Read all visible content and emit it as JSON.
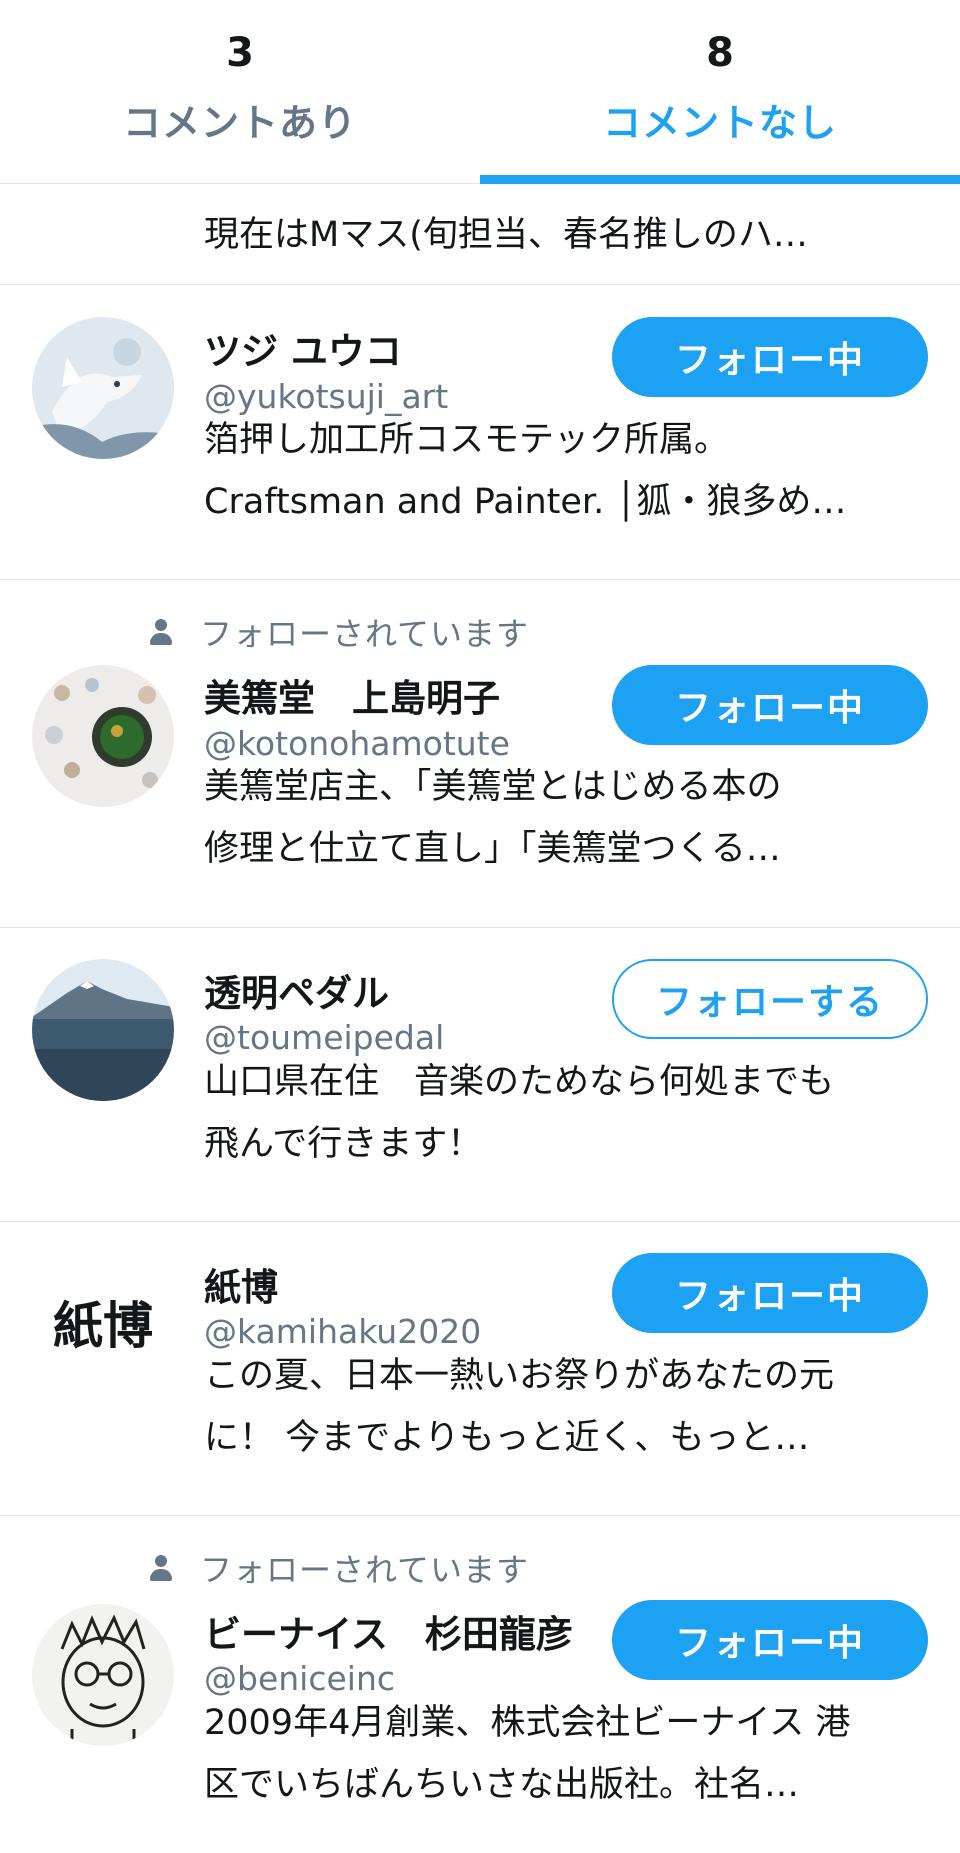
{
  "tabs": [
    {
      "count": "3",
      "label": "コメントあり",
      "active": false
    },
    {
      "count": "8",
      "label": "コメントなし",
      "active": true
    }
  ],
  "first_row": {
    "bio_line": "現在はMマス(旬担当、春名推しのハ…"
  },
  "users": [
    {
      "name": "ツジ ユウコ",
      "handle": "@yukotsuji_art",
      "followed_by": "",
      "button": "フォロー中",
      "bio": [
        "箔押し加工所コスモテック所属。",
        "Craftsman and Painter. │狐・狼多め…"
      ]
    },
    {
      "name": "美篶堂　上島明子",
      "handle": "@kotonohamotute",
      "followed_by": "フォローされています",
      "button": "フォロー中",
      "bio": [
        "美篶堂店主、「美篶堂とはじめる本の",
        "修理と仕立て直し」「美篶堂つくる…"
      ]
    },
    {
      "name": "透明ペダル",
      "handle": "@toumeipedal",
      "followed_by": "",
      "button": "フォローする",
      "bio": [
        "山口県在住　音楽のためなら何処までも",
        "飛んで行きます！"
      ]
    },
    {
      "name": "紙博",
      "handle": "@kamihaku2020",
      "followed_by": "",
      "button": "フォロー中",
      "avatar_text": "紙博",
      "bio": [
        "この夏、日本一熱いお祭りがあなたの元",
        "に！ 今までよりもっと近く、もっと…"
      ]
    },
    {
      "name": "ビーナイス　杉田龍彦",
      "handle": "@beniceinc",
      "followed_by": "フォローされています",
      "button": "フォロー中",
      "bio": [
        "2009年4月創業、株式会社ビーナイス 港",
        "区でいちばんちいさな出版社。社名…"
      ]
    }
  ],
  "colors": {
    "accent": "#1da1f2",
    "secondary_text": "#657786",
    "divider": "#e1e8ed"
  }
}
